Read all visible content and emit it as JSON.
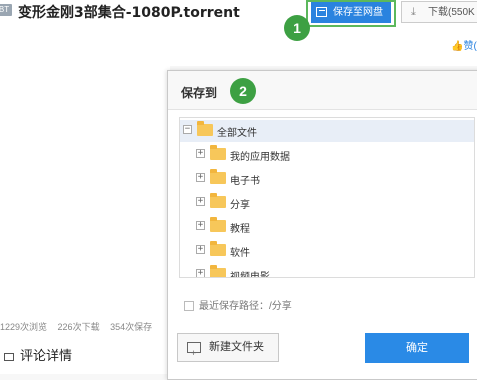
{
  "file": {
    "badge": "BT",
    "title": "变形金刚3部集合-1080P.torrent"
  },
  "toolbar": {
    "save_label": "保存至网盘",
    "download_label": "下载(550K"
  },
  "steps": {
    "one": "1",
    "two": "2"
  },
  "like": {
    "label": "赞("
  },
  "stats": {
    "views": "1229次浏览",
    "downloads": "226次下载",
    "saves": "354次保存"
  },
  "comments": {
    "title": "评论详情"
  },
  "dialog": {
    "title": "保存到",
    "tree": {
      "root": "全部文件",
      "children": [
        "我的应用数据",
        "电子书",
        "分享",
        "教程",
        "软件",
        "视频电影"
      ]
    },
    "recent_path": "最近保存路径：/分享",
    "new_folder_label": "新建文件夹",
    "confirm_label": "确定"
  },
  "colors": {
    "accent_blue": "#2a83df",
    "step_green": "#3da043",
    "folder_yellow": "#f7c75a"
  }
}
